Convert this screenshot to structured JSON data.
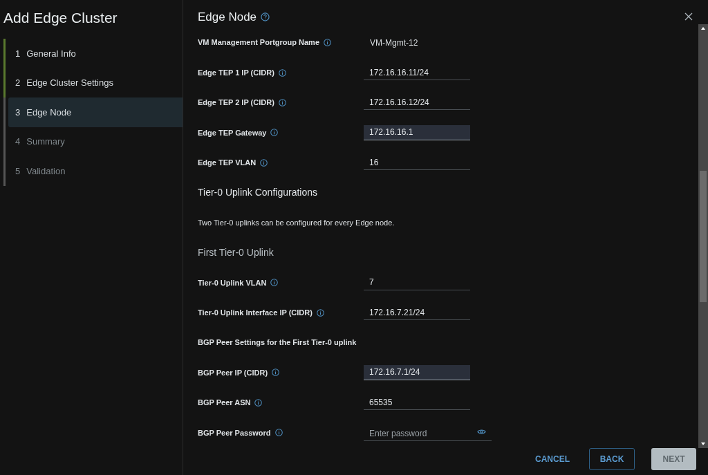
{
  "wizard": {
    "title": "Add Edge Cluster"
  },
  "steps": [
    {
      "number": "1",
      "label": "General Info",
      "completed": true,
      "disabled": false,
      "selected": false
    },
    {
      "number": "2",
      "label": "Edge Cluster Settings",
      "completed": true,
      "disabled": false,
      "selected": false
    },
    {
      "number": "3",
      "label": "Edge Node",
      "completed": false,
      "disabled": false,
      "selected": true
    },
    {
      "number": "4",
      "label": "Summary",
      "completed": false,
      "disabled": true,
      "selected": false
    },
    {
      "number": "5",
      "label": "Validation",
      "completed": false,
      "disabled": true,
      "selected": false
    }
  ],
  "page_title": "Edge Node",
  "items": [
    {
      "kind": "readonly",
      "label": "VM Management Portgroup Name",
      "value": "VM-Mgmt-12"
    },
    {
      "kind": "input",
      "label": "Edge TEP 1 IP (CIDR)",
      "value": "172.16.16.11/24",
      "focused": false
    },
    {
      "kind": "input",
      "label": "Edge TEP 2 IP (CIDR)",
      "value": "172.16.16.12/24",
      "focused": false
    },
    {
      "kind": "input",
      "label": "Edge TEP Gateway",
      "value": "172.16.16.1",
      "focused": true
    },
    {
      "kind": "input",
      "label": "Edge TEP VLAN",
      "value": "16",
      "focused": false
    },
    {
      "kind": "heading",
      "text": "Tier-0 Uplink Configurations"
    },
    {
      "kind": "note",
      "text": "Two Tier-0 uplinks can be configured for every Edge node."
    },
    {
      "kind": "subheading",
      "text": "First Tier-0 Uplink"
    },
    {
      "kind": "input",
      "label": "Tier-0 Uplink VLAN",
      "value": "7",
      "focused": false
    },
    {
      "kind": "input",
      "label": "Tier-0 Uplink Interface IP (CIDR)",
      "value": "172.16.7.21/24",
      "focused": false
    },
    {
      "kind": "group",
      "text": "BGP Peer Settings for the First Tier-0 uplink"
    },
    {
      "kind": "input",
      "label": "BGP Peer IP (CIDR)",
      "value": "172.16.7.1/24",
      "focused": true
    },
    {
      "kind": "input",
      "label": "BGP Peer ASN",
      "value": "65535",
      "focused": false
    },
    {
      "kind": "password",
      "label": "BGP Peer Password",
      "placeholder": "Enter password"
    }
  ],
  "buttons": [
    {
      "label": "CANCEL",
      "kind": "link",
      "disabled": false
    },
    {
      "label": "BACK",
      "kind": "outline",
      "disabled": false
    },
    {
      "label": "NEXT",
      "kind": "solid",
      "disabled": true
    }
  ]
}
